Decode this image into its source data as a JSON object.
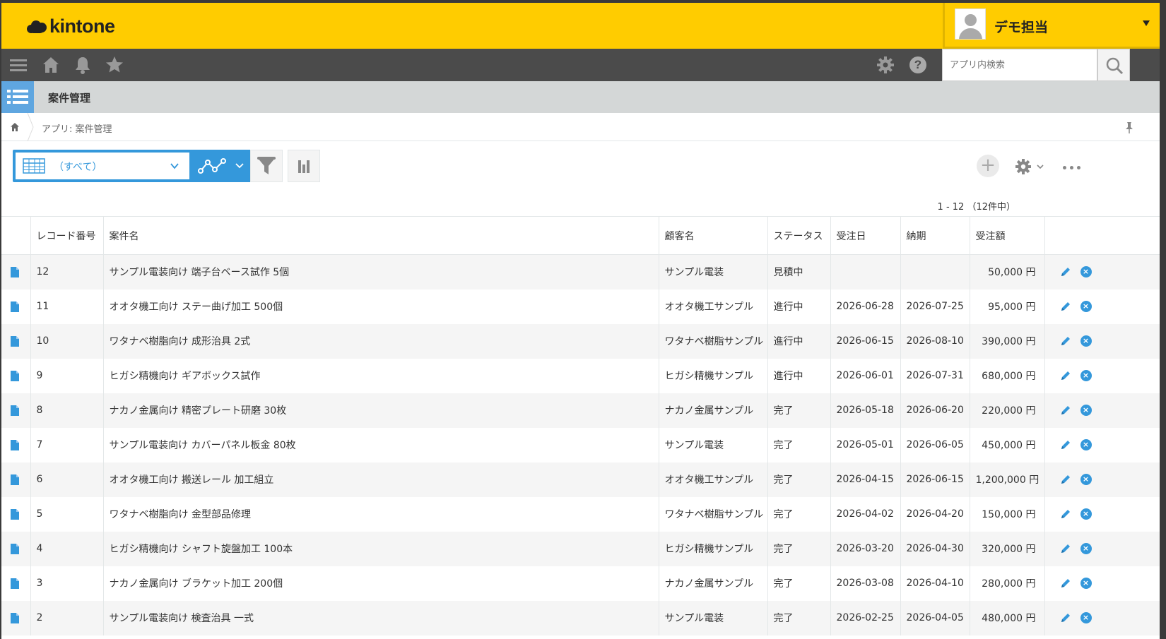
{
  "header": {
    "brand": "kintone",
    "user_name": "デモ担当"
  },
  "gnav": {
    "search_placeholder": "アプリ内検索"
  },
  "app": {
    "title": "案件管理"
  },
  "breadcrumb": {
    "text": "アプリ: 案件管理"
  },
  "toolbar": {
    "view_label": "（すべて）",
    "pager": "1 - 12 （12件中）"
  },
  "table": {
    "columns": [
      "レコード番号",
      "案件名",
      "顧客名",
      "ステータス",
      "受注日",
      "納期",
      "受注額"
    ],
    "rows": [
      {
        "id": "12",
        "name": "サンプル電装向け 端子台ベース試作 5個",
        "customer": "サンプル電装",
        "status": "見積中",
        "order_date": "",
        "due": "",
        "amount": "50,000 円"
      },
      {
        "id": "11",
        "name": "オオタ機工向け ステー曲げ加工 500個",
        "customer": "オオタ機工サンプル",
        "status": "進行中",
        "order_date": "2026-06-28",
        "due": "2026-07-25",
        "amount": "95,000 円"
      },
      {
        "id": "10",
        "name": "ワタナベ樹脂向け 成形治具 2式",
        "customer": "ワタナベ樹脂サンプル",
        "status": "進行中",
        "order_date": "2026-06-15",
        "due": "2026-08-10",
        "amount": "390,000 円"
      },
      {
        "id": "9",
        "name": "ヒガシ精機向け ギアボックス試作",
        "customer": "ヒガシ精機サンプル",
        "status": "進行中",
        "order_date": "2026-06-01",
        "due": "2026-07-31",
        "amount": "680,000 円"
      },
      {
        "id": "8",
        "name": "ナカノ金属向け 精密プレート研磨 30枚",
        "customer": "ナカノ金属サンプル",
        "status": "完了",
        "order_date": "2026-05-18",
        "due": "2026-06-20",
        "amount": "220,000 円"
      },
      {
        "id": "7",
        "name": "サンプル電装向け カバーパネル板金 80枚",
        "customer": "サンプル電装",
        "status": "完了",
        "order_date": "2026-05-01",
        "due": "2026-06-05",
        "amount": "450,000 円"
      },
      {
        "id": "6",
        "name": "オオタ機工向け 搬送レール 加工組立",
        "customer": "オオタ機工サンプル",
        "status": "完了",
        "order_date": "2026-04-15",
        "due": "2026-06-15",
        "amount": "1,200,000 円"
      },
      {
        "id": "5",
        "name": "ワタナベ樹脂向け 金型部品修理",
        "customer": "ワタナベ樹脂サンプル",
        "status": "完了",
        "order_date": "2026-04-02",
        "due": "2026-04-20",
        "amount": "150,000 円"
      },
      {
        "id": "4",
        "name": "ヒガシ精機向け シャフト旋盤加工 100本",
        "customer": "ヒガシ精機サンプル",
        "status": "完了",
        "order_date": "2026-03-20",
        "due": "2026-04-30",
        "amount": "320,000 円"
      },
      {
        "id": "3",
        "name": "ナカノ金属向け ブラケット加工 200個",
        "customer": "ナカノ金属サンプル",
        "status": "完了",
        "order_date": "2026-03-08",
        "due": "2026-04-10",
        "amount": "280,000 円"
      },
      {
        "id": "2",
        "name": "サンプル電装向け 検査治具 一式",
        "customer": "サンプル電装",
        "status": "完了",
        "order_date": "2026-02-25",
        "due": "2026-04-05",
        "amount": "480,000 円"
      }
    ]
  },
  "colors": {
    "header_yellow": "#ffcc00",
    "gnav_dark": "#4b4b4b",
    "accent_blue": "#3498db",
    "appbar_gray": "#d4d7d7"
  },
  "icons": [
    "menu-icon",
    "home-icon",
    "bell-icon",
    "star-icon",
    "gear-icon",
    "help-icon",
    "search-icon",
    "list-app-icon",
    "pin-icon",
    "table-view-icon",
    "graph-icon",
    "filter-icon",
    "bar-chart-icon",
    "plus-icon",
    "more-icon",
    "document-icon",
    "pencil-icon",
    "close-circle-icon"
  ]
}
